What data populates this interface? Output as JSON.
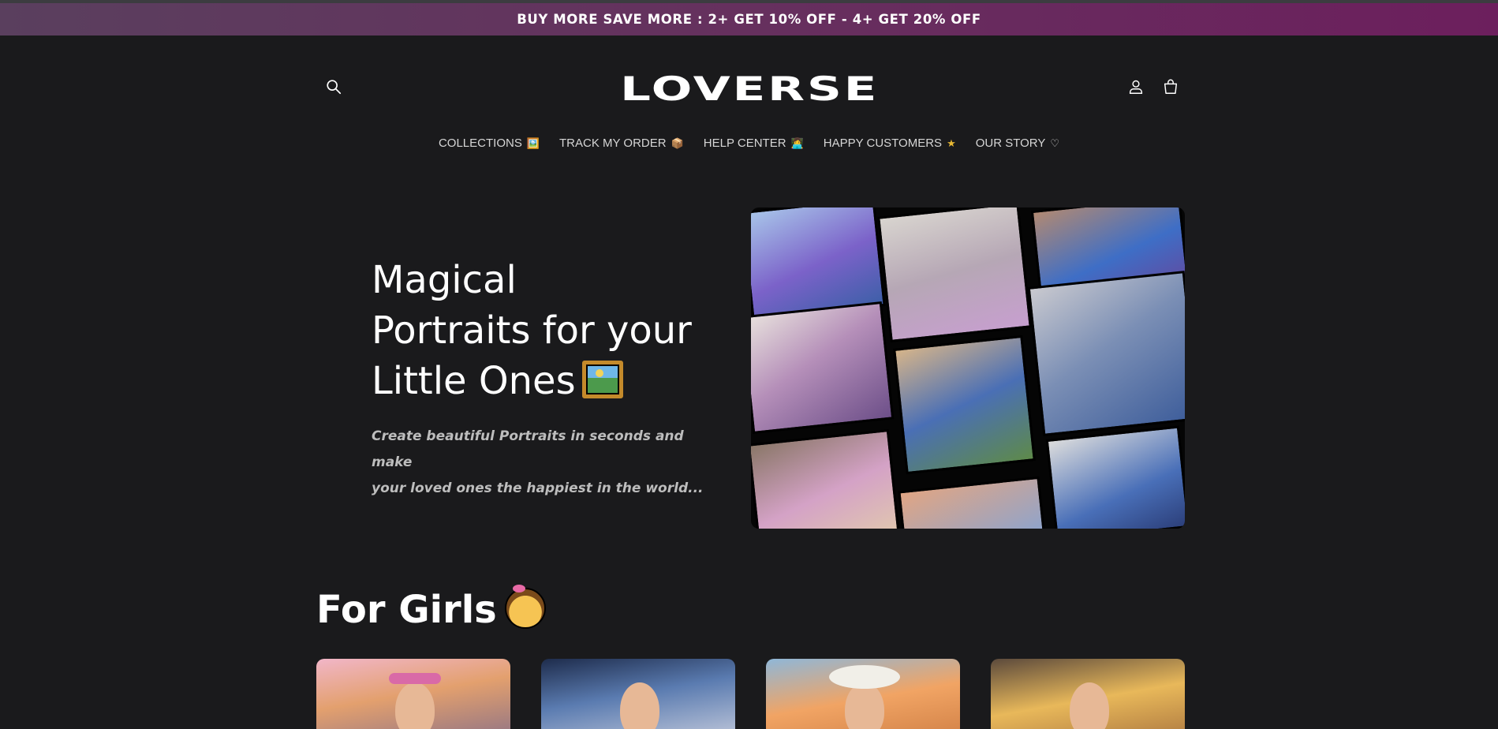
{
  "announcement": {
    "text": "BUY MORE SAVE MORE : 2+ GET 10% OFF - 4+ GET 20% OFF"
  },
  "header": {
    "logo_text": "LOVERSE",
    "icons": {
      "search": "search-icon",
      "account": "user-icon",
      "cart": "cart-icon"
    }
  },
  "nav": {
    "items": [
      {
        "label": "COLLECTIONS",
        "emoji": "🖼️"
      },
      {
        "label": "TRACK MY ORDER",
        "emoji": "📦"
      },
      {
        "label": "HELP CENTER",
        "emoji": "👩‍💻"
      },
      {
        "label": "HAPPY CUSTOMERS",
        "emoji": "★"
      },
      {
        "label": "OUR STORY",
        "emoji": "♡"
      }
    ]
  },
  "hero": {
    "title_line1": "Magical",
    "title_line2": "Portraits for your",
    "title_line3": "Little Ones",
    "subtitle_line1": "Create beautiful Portraits in seconds and make",
    "subtitle_line2": "your loved ones the happiest in the world..."
  },
  "section": {
    "title": "For Girls"
  },
  "colors": {
    "background": "#1a1a1c",
    "announcement_start": "#5a3f5e",
    "announcement_end": "#6c1f5d",
    "nav_text": "#d6d6d6",
    "subtitle": "#bdbdbd"
  }
}
